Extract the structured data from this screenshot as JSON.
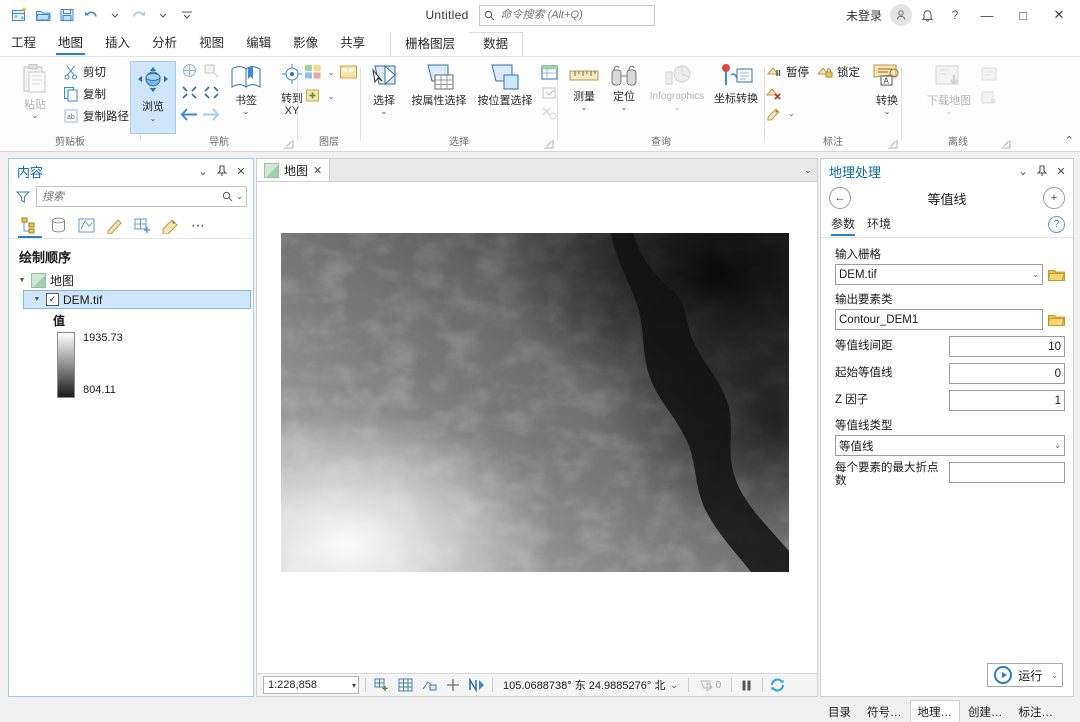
{
  "titlebar": {
    "doc_title": "Untitled",
    "search_placeholder": "命令搜索 (Alt+Q)",
    "signin": "未登录",
    "quick_access": [
      {
        "name": "new-project-icon"
      },
      {
        "name": "open-project-icon"
      },
      {
        "name": "save-project-icon"
      },
      {
        "name": "undo-icon"
      },
      {
        "name": "redo-icon"
      },
      {
        "name": "customize-qat-icon"
      }
    ],
    "window": {
      "minimize": "—",
      "maximize": "□",
      "close": "✕",
      "help": "?"
    }
  },
  "ribbon": {
    "tabs": [
      {
        "label": "工程",
        "active": false
      },
      {
        "label": "地图",
        "active": true
      },
      {
        "label": "插入",
        "active": false
      },
      {
        "label": "分析",
        "active": false
      },
      {
        "label": "视图",
        "active": false
      },
      {
        "label": "编辑",
        "active": false
      },
      {
        "label": "影像",
        "active": false
      },
      {
        "label": "共享",
        "active": false
      }
    ],
    "context_tabs": [
      {
        "label": "栅格图层",
        "active": true
      },
      {
        "label": "数据",
        "active": false
      }
    ],
    "groups": {
      "clipboard": {
        "label": "剪贴板",
        "paste": "粘贴",
        "cut": "剪切",
        "copy": "复制",
        "copy_path": "复制路径"
      },
      "navigate": {
        "label": "导航",
        "explore": "浏览",
        "bookmarks": "书签",
        "goto_xy": "转到\nXY"
      },
      "layer": {
        "label": "图层"
      },
      "selection": {
        "label": "选择",
        "select": "选择",
        "select_by_attributes": "按属性选择",
        "select_by_location": "按位置选择"
      },
      "inquiry": {
        "label": "查询",
        "measure": "测量",
        "locate": "定位",
        "infographics": "Infographics",
        "convert_coordinates": "坐标转换"
      },
      "labeling": {
        "label": "标注",
        "pause": "暂停",
        "lock": "锁定",
        "convert": "转换"
      },
      "offline": {
        "label": "离线",
        "download_map": "下载地图"
      }
    }
  },
  "contents_pane": {
    "title": "内容",
    "search_placeholder": "搜索",
    "tools": [
      {
        "name": "list-by-drawing-order-icon",
        "active": true
      },
      {
        "name": "list-by-data-source-icon",
        "active": false
      },
      {
        "name": "list-by-selection-icon",
        "active": false
      },
      {
        "name": "list-by-editing-icon",
        "active": false
      },
      {
        "name": "list-by-snapping-icon",
        "active": false
      },
      {
        "name": "list-by-labeling-icon",
        "active": false
      }
    ],
    "more": "⋯",
    "drawing_order_label": "绘制顺序",
    "map_node": "地图",
    "layer": {
      "name": "DEM.tif",
      "checked": true,
      "legend_title": "值",
      "max_value": "1935.73",
      "min_value": "804.11"
    }
  },
  "map_view": {
    "tab_label": "地图",
    "close_glyph": "✕",
    "status": {
      "scale": "1:228,858",
      "coordinates": "105.0688738° 东 24.9885276° 北",
      "selection_count": "0"
    }
  },
  "geoprocessing": {
    "title": "地理处理",
    "tool_title": "等值线",
    "tabs": [
      {
        "label": "参数",
        "active": true
      },
      {
        "label": "环境",
        "active": false
      }
    ],
    "help_glyph": "?",
    "fields": {
      "input_raster": {
        "label": "输入栅格",
        "value": "DEM.tif"
      },
      "output_features": {
        "label": "输出要素类",
        "value": "Contour_DEM1"
      },
      "contour_interval": {
        "label": "等值线间距",
        "value": "10"
      },
      "base_contour": {
        "label": "起始等值线",
        "value": "0"
      },
      "z_factor": {
        "label": "Z 因子",
        "value": "1"
      },
      "contour_type": {
        "label": "等值线类型",
        "value": "等值线"
      },
      "max_vertices": {
        "label": "每个要素的最大折点数",
        "value": ""
      }
    },
    "run_button": "运行",
    "bottom_tabs": [
      {
        "label": "目录",
        "active": false
      },
      {
        "label": "符号…",
        "active": false
      },
      {
        "label": "地理…",
        "active": true
      },
      {
        "label": "创建…",
        "active": false
      },
      {
        "label": "标注…",
        "active": false
      }
    ]
  },
  "colors": {
    "accent": "#2a7fc9",
    "pane_title": "#0b6ba8",
    "selection": "#cfe6fa",
    "ribbon_bg": "#fdfdfd"
  }
}
